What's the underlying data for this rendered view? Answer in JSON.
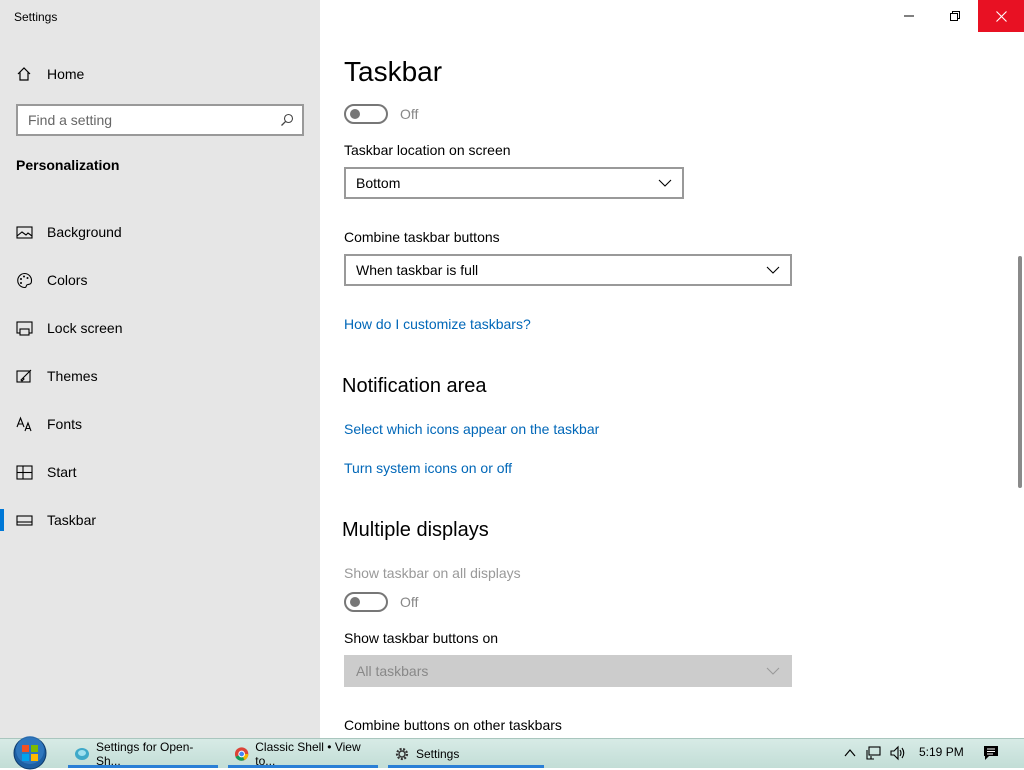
{
  "app": {
    "title": "Settings"
  },
  "sidebar": {
    "home_label": "Home",
    "search_placeholder": "Find a setting",
    "section_title": "Personalization",
    "items": [
      {
        "label": "Background",
        "icon": "picture-icon"
      },
      {
        "label": "Colors",
        "icon": "palette-icon"
      },
      {
        "label": "Lock screen",
        "icon": "lock-screen-icon"
      },
      {
        "label": "Themes",
        "icon": "paintbrush-icon"
      },
      {
        "label": "Fonts",
        "icon": "font-icon"
      },
      {
        "label": "Start",
        "icon": "start-icon"
      },
      {
        "label": "Taskbar",
        "icon": "taskbar-icon",
        "active": true
      }
    ]
  },
  "main": {
    "title": "Taskbar",
    "top_toggle_state": "Off",
    "location_label": "Taskbar location on screen",
    "location_value": "Bottom",
    "combine_label": "Combine taskbar buttons",
    "combine_value": "When taskbar is full",
    "customize_link": "How do I customize taskbars?",
    "notification_heading": "Notification area",
    "select_icons_link": "Select which icons appear on the taskbar",
    "system_icons_link": "Turn system icons on or off",
    "multi_heading": "Multiple displays",
    "show_all_label": "Show taskbar on all displays",
    "show_all_state": "Off",
    "show_buttons_label": "Show taskbar buttons on",
    "show_buttons_value": "All taskbars",
    "combine_other_label": "Combine buttons on other taskbars"
  },
  "taskbar": {
    "buttons": [
      {
        "label": "Settings for Open-Sh...",
        "icon": "open-shell-icon"
      },
      {
        "label": "Classic Shell • View to...",
        "icon": "chrome-icon"
      },
      {
        "label": "Settings",
        "icon": "gear-icon"
      }
    ],
    "clock": "5:19 PM"
  },
  "colors": {
    "accent": "#0078d7",
    "link": "#0067b8",
    "close": "#e81123"
  }
}
